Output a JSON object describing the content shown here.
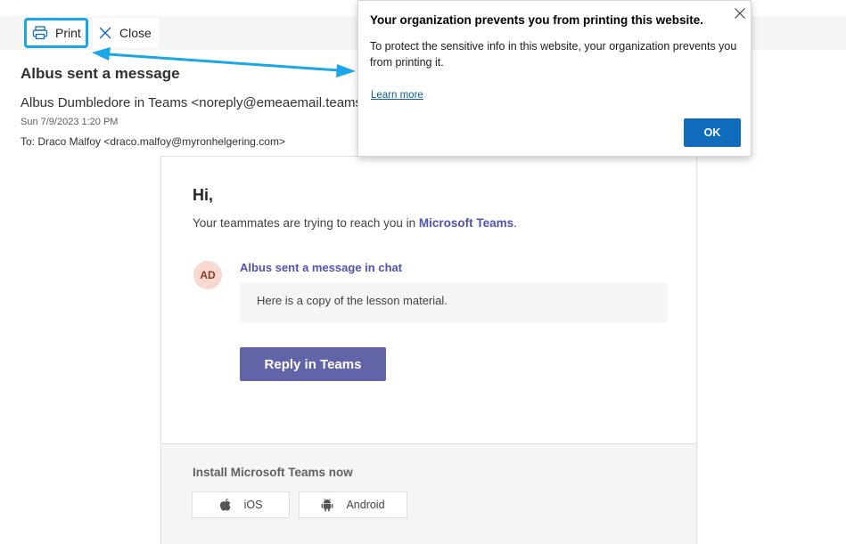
{
  "toolbar": {
    "print_label": "Print",
    "print_icon": "printer-icon",
    "close_label": "Close",
    "close_icon": "close-icon",
    "highlight_color": "#19a7e8"
  },
  "header": {
    "subject": "Albus sent a message",
    "from": "Albus Dumbledore in Teams <noreply@emeaemail.teams.microsoft.com>",
    "date": "Sun 7/9/2023 1:20 PM",
    "to": "To: Draco Malfoy <draco.malfoy@myronhelgering.com>"
  },
  "email": {
    "greeting": "Hi,",
    "intro_prefix": "Your teammates are trying to reach you in ",
    "intro_brand": "Microsoft Teams",
    "intro_suffix": ".",
    "avatar_initials": "AD",
    "chat_title": "Albus sent a message in chat",
    "message": "Here is a copy of the lesson material.",
    "reply_button": "Reply in Teams",
    "brand_color": "#6264a7",
    "footer": {
      "install_label": "Install Microsoft Teams now",
      "ios_label": "iOS",
      "ios_icon": "apple-icon",
      "android_label": "Android",
      "android_icon": "android-icon"
    }
  },
  "dialog": {
    "title": "Your organization prevents you from printing this website.",
    "body": "To protect the sensitive info in this website, your organization prevents you from printing it.",
    "link": "Learn more",
    "ok_button": "OK",
    "close_icon": "close-icon",
    "accent_color": "#0f6cbd"
  }
}
